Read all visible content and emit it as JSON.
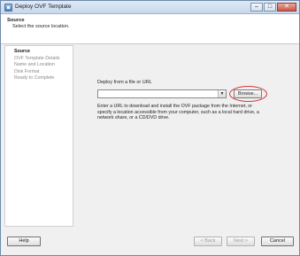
{
  "window": {
    "title": "Deploy OVF Template",
    "controls": {
      "minimize": "–",
      "maximize": "□",
      "close": "✕"
    }
  },
  "header": {
    "title": "Source",
    "subtitle": "Select the source location."
  },
  "nav": {
    "items": [
      {
        "label": "Source",
        "active": true
      },
      {
        "label": "OVF Template Details",
        "active": false
      },
      {
        "label": "Name and Location",
        "active": false
      },
      {
        "label": "Disk Format",
        "active": false
      },
      {
        "label": "Ready to Complete",
        "active": false
      }
    ]
  },
  "source": {
    "label": "Deploy from a file or URL",
    "url_value": "",
    "combo_arrow": "▼",
    "browse_label": "Browse...",
    "help_text": "Enter a URL to download and install the OVF package from the Internet, or specify a location accessible from your computer, such as a local hard drive, a network share, or a CD/DVD drive."
  },
  "footer": {
    "help_label": "Help",
    "back_label": "< Back",
    "next_label": "Next >",
    "cancel_label": "Cancel"
  },
  "colors": {
    "highlight": "#d23a3a",
    "titlebar": "#c7d8ed",
    "window_background": "#f0f0f0"
  }
}
